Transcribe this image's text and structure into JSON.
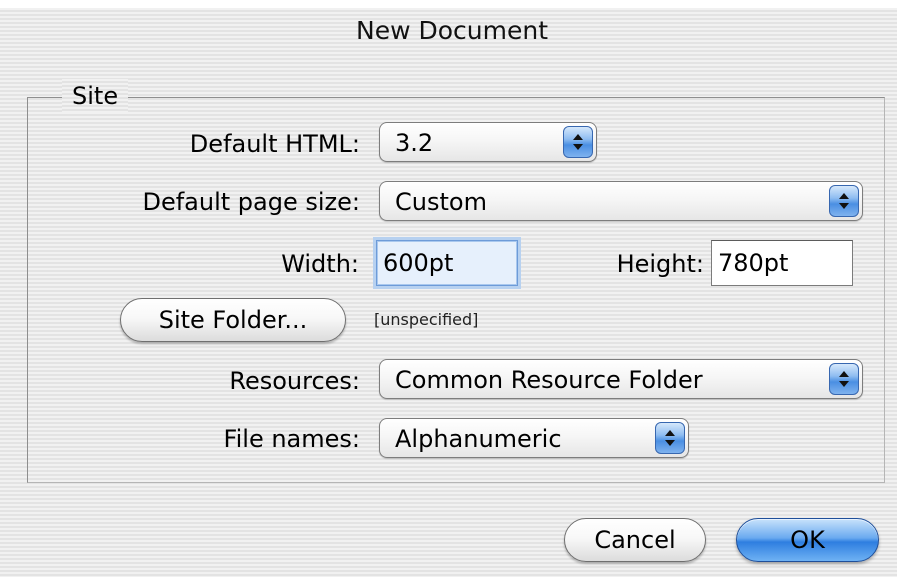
{
  "window": {
    "title": "New Document"
  },
  "site_group": {
    "label": "Site",
    "default_html": {
      "label": "Default HTML:",
      "value": "3.2"
    },
    "default_page_size": {
      "label": "Default page size:",
      "value": "Custom"
    },
    "width": {
      "label": "Width:",
      "value": "600pt"
    },
    "height": {
      "label": "Height:",
      "value": "780pt"
    },
    "site_folder": {
      "button_label": "Site Folder...",
      "path": "[unspecified]"
    },
    "resources": {
      "label": "Resources:",
      "value": "Common Resource Folder"
    },
    "file_names": {
      "label": "File names:",
      "value": "Alphanumeric"
    }
  },
  "buttons": {
    "cancel": "Cancel",
    "ok": "OK"
  },
  "colors": {
    "default_button": "#4a8fe2",
    "focus_ring": "#b7d1f0"
  },
  "icons": {
    "popup_arrows": "up-down-arrows-icon"
  }
}
